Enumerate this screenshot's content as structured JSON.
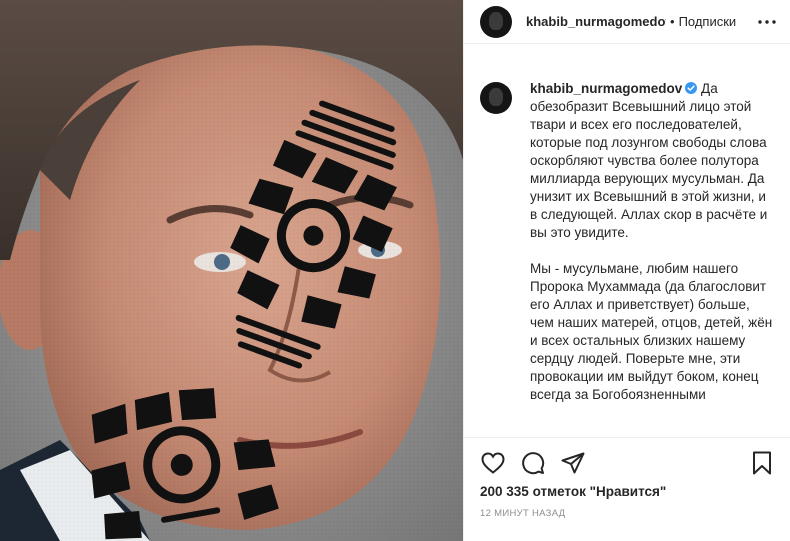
{
  "colors": {
    "text": "#262626",
    "muted": "#8e8e8e",
    "verified": "#3897f0",
    "divider": "#efefef"
  },
  "photo": {
    "description_icons": [
      "portrait-photo",
      "boot-print-icon"
    ]
  },
  "header": {
    "username": "khabib_nurmagomedov",
    "separator": "•",
    "follow_label": "Подписки",
    "more_icon": "ellipsis-icon"
  },
  "caption": {
    "username": "khabib_nurmagomedov",
    "verified_icon": "verified-badge-icon",
    "paragraph1": "Да обезобразит Всевышний лицо этой твари и всех его последователей, которые под лозунгом свободы слова оскорбляют чувства более полутора миллиарда верующих мусульман. Да унизит их Всевышний в этой жизни, и в следующей. Аллах скор в расчёте и вы это увидите.",
    "paragraph2": "Мы - мусульмане, любим нашего Пророка Мухаммада (да благословит его Аллах и приветствует) больше, чем наших матерей, отцов, детей, жён и всех остальных близких нашему сердцу людей. Поверьте мне, эти провокации им выйдут боком, конец всегда за Богобоязненными"
  },
  "actions": {
    "like_icon": "heart-icon",
    "comment_icon": "comment-icon",
    "share_icon": "share-icon",
    "save_icon": "bookmark-icon"
  },
  "likes": {
    "count": "200 335",
    "label": "отметок \"Нравится\""
  },
  "timestamp": "12 минут назад"
}
